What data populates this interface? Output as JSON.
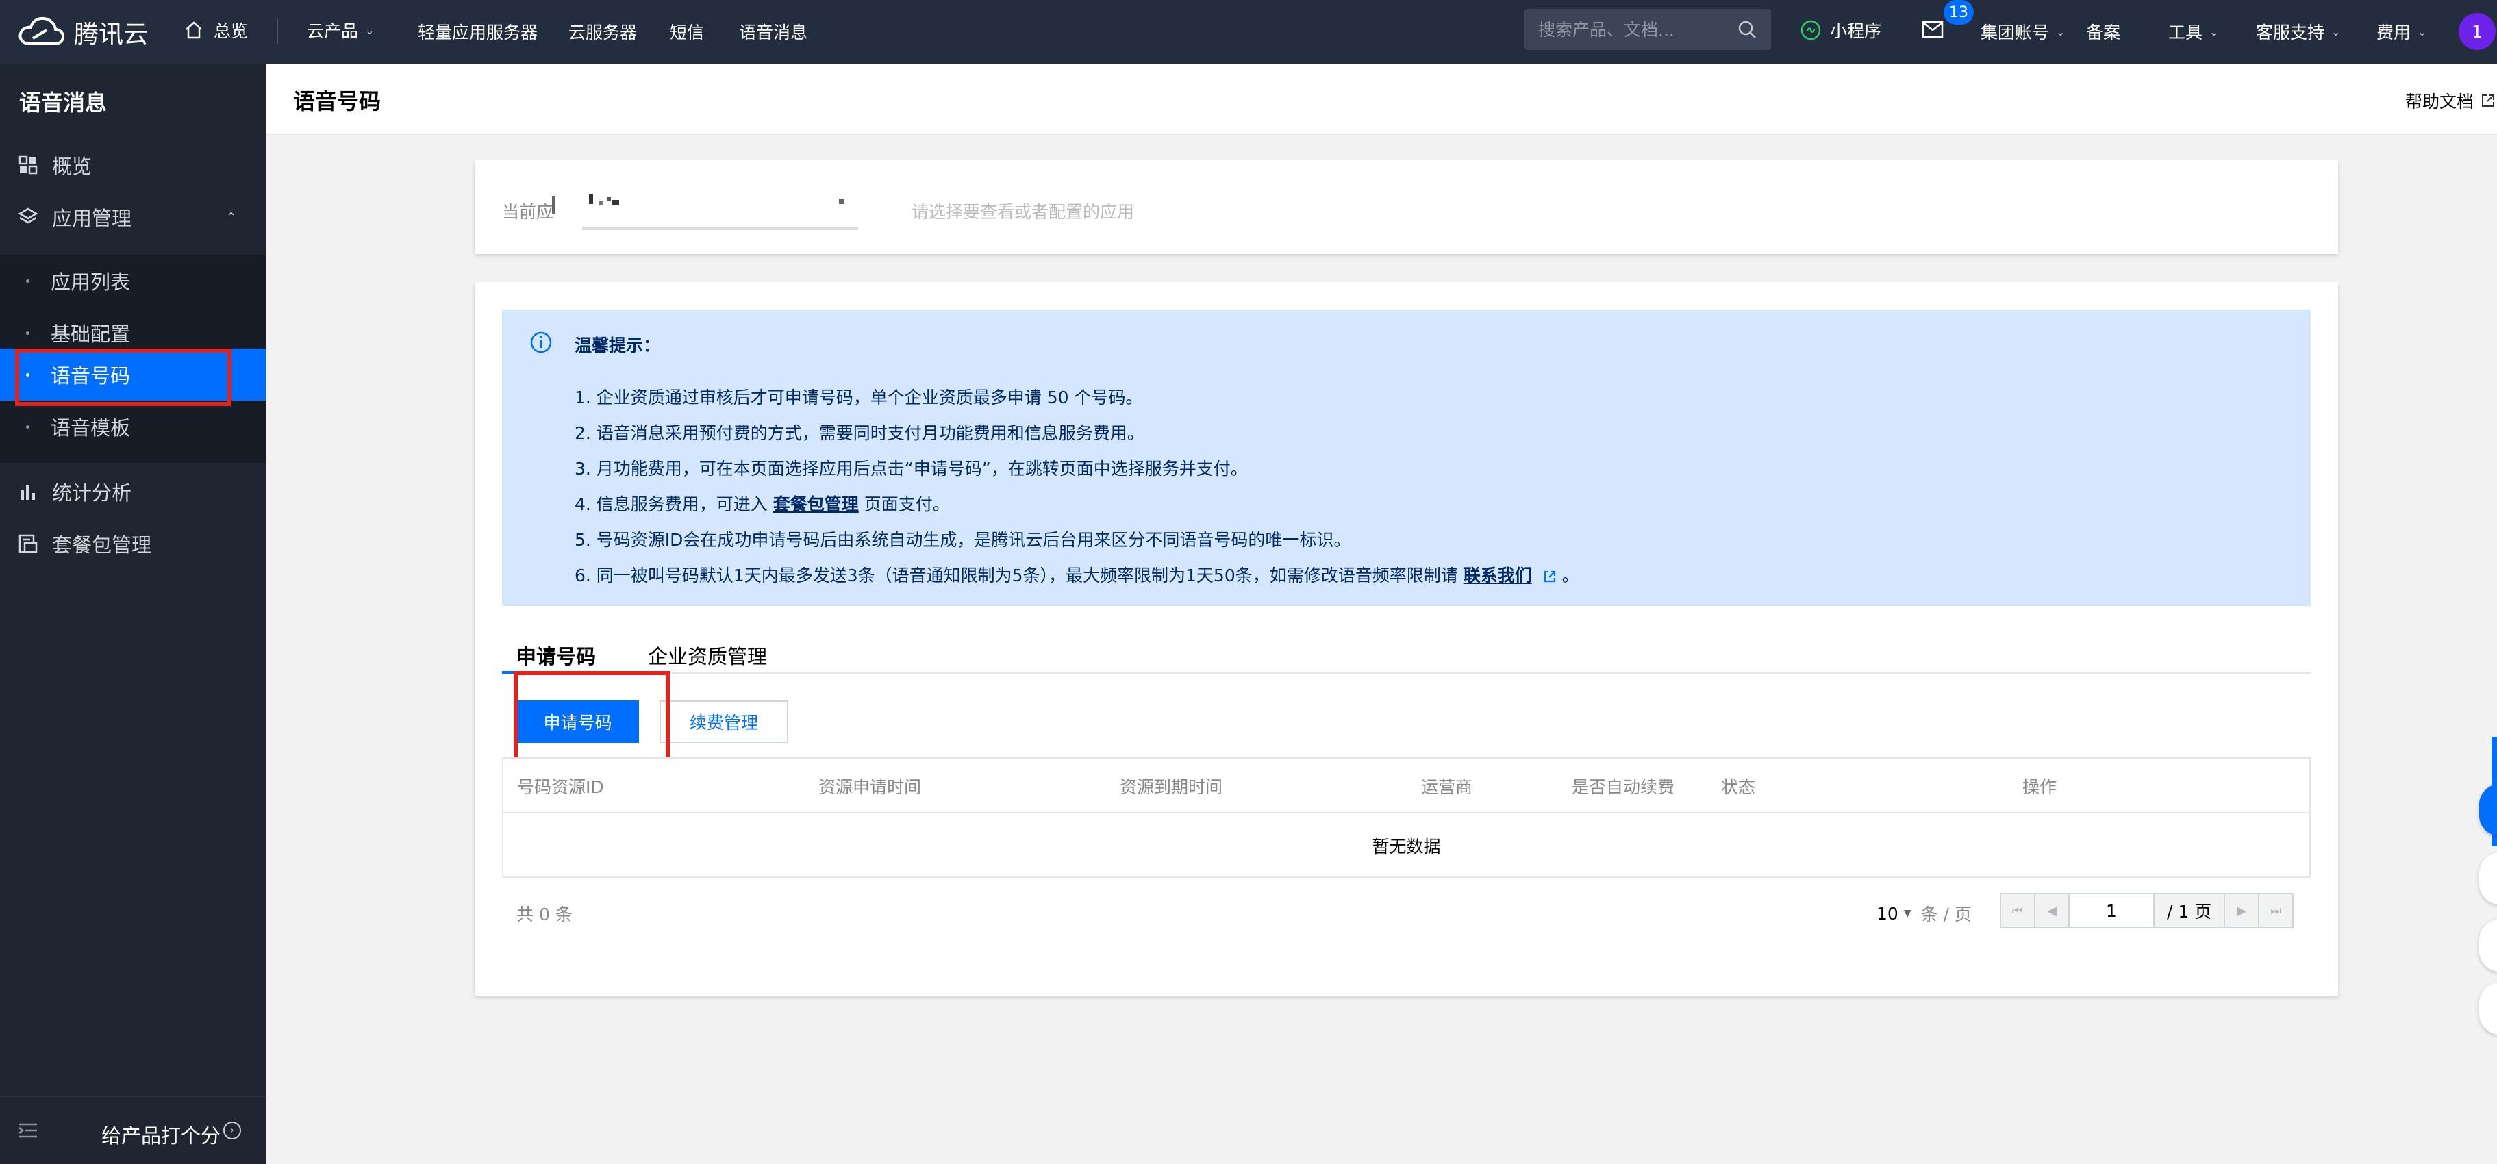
{
  "topnav": {
    "logo_text": "腾讯云",
    "home_label": "总览",
    "products_label": "云产品",
    "nav_items": [
      "轻量应用服务器",
      "云服务器",
      "短信",
      "语音消息"
    ],
    "search_placeholder": "搜索产品、文档...",
    "mini_program_label": "小程序",
    "mail_badge": "13",
    "group_account_label": "集团账号",
    "beian_label": "备案",
    "tools_label": "工具",
    "support_label": "客服支持",
    "fee_label": "费用",
    "avatar_text": "1"
  },
  "sidebar": {
    "title": "语音消息",
    "overview": "概览",
    "app_manage": "应用管理",
    "sub_items": [
      "应用列表",
      "基础配置",
      "语音号码",
      "语音模板"
    ],
    "active_item": "语音号码",
    "stats": "统计分析",
    "package": "套餐包管理",
    "rate_label": "给产品打个分"
  },
  "header": {
    "title": "语音号码",
    "help": "帮助文档"
  },
  "app_select": {
    "label": "当前应",
    "hint": "请选择要查看或者配置的应用"
  },
  "notice": {
    "title": "温馨提示：",
    "line1": "1. 企业资质通过审核后才可申请号码，单个企业资质最多申请 50 个号码。",
    "line2": "2. 语音消息采用预付费的方式，需要同时支付月功能费用和信息服务费用。",
    "line3": "3. 月功能费用，可在本页面选择应用后点击“申请号码”，在跳转页面中选择服务并支付。",
    "line4_pre": "4. 信息服务费用，可进入 ",
    "line4_link": "套餐包管理",
    "line4_post": " 页面支付。",
    "line5": "5. 号码资源ID会在成功申请号码后由系统自动生成，是腾讯云后台用来区分不同语音号码的唯一标识。",
    "line6_pre": "6. 同一被叫号码默认1天内最多发送3条（语音通知限制为5条），最大频率限制为1天50条，如需修改语音频率限制请 ",
    "line6_link": "联系我们",
    "line6_post": " 。"
  },
  "tabs": [
    "申请号码",
    "企业资质管理"
  ],
  "buttons": {
    "apply": "申请号码",
    "renew": "续费管理"
  },
  "table": {
    "columns": [
      "号码资源ID",
      "资源申请时间",
      "资源到期时间",
      "运营商",
      "是否自动续费",
      "状态",
      "操作"
    ],
    "empty_text": "暂无数据"
  },
  "pager": {
    "total": "共 0 条",
    "page_size": "10",
    "per_page_label": "条 / 页",
    "current_page": "1",
    "total_pages": "/ 1 页"
  },
  "colors": {
    "nav_bg": "#232d3d",
    "sidebar_bg": "#1f2632",
    "primary": "#006eff",
    "notice_bg": "#d5e7fe",
    "highlight": "#e0241d"
  }
}
